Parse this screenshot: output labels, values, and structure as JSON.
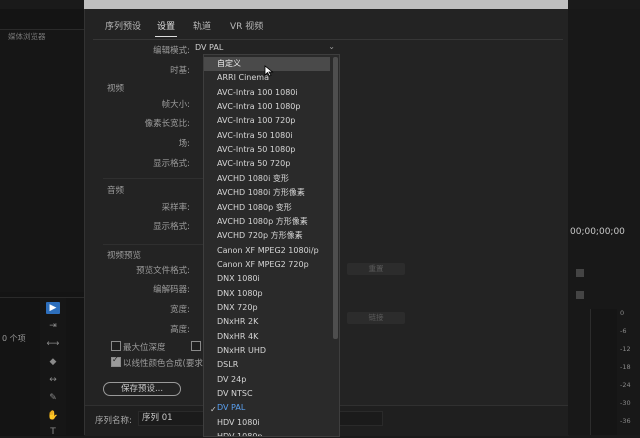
{
  "left_panel": {
    "label": "媒体浏览器",
    "item_count": "0 个项"
  },
  "tabs": [
    {
      "label": "序列预设",
      "active": false
    },
    {
      "label": "设置",
      "active": true
    },
    {
      "label": "轨道",
      "active": false
    },
    {
      "label": "VR 视频",
      "active": false
    }
  ],
  "settings": {
    "edit_mode_label": "编辑模式:",
    "edit_mode_value": "DV PAL",
    "timebase_label": "时基:",
    "video_section": "视频",
    "frame_size_label": "帧大小:",
    "pixel_aspect_label": "像素长宽比:",
    "fields_label": "场:",
    "display_format_label": "显示格式:",
    "audio_section": "音频",
    "sample_rate_label": "采样率:",
    "audio_display_format_label": "显示格式:",
    "video_preview_section": "视频预览",
    "preview_file_format_label": "预览文件格式:",
    "codec_label": "编解码器:",
    "width_label": "宽度:",
    "height_label": "高度:",
    "reset_button": "重置",
    "other_button": "链接",
    "max_depth_label": "最大位深度",
    "max_quality_label": "最",
    "linear_composite_label": "以线性颜色合成(要求",
    "save_preset_button": "保存预设...",
    "sequence_name_label": "序列名称:",
    "sequence_name_value": "序列 01"
  },
  "dropdown_options": [
    {
      "label": "自定义",
      "state": "hover"
    },
    {
      "label": "ARRI Cinema"
    },
    {
      "label": "AVC-Intra 100 1080i"
    },
    {
      "label": "AVC-Intra 100 1080p"
    },
    {
      "label": "AVC-Intra 100 720p"
    },
    {
      "label": "AVC-Intra 50 1080i"
    },
    {
      "label": "AVC-Intra 50 1080p"
    },
    {
      "label": "AVC-Intra 50 720p"
    },
    {
      "label": "AVCHD 1080i 变形"
    },
    {
      "label": "AVCHD 1080i 方形像素"
    },
    {
      "label": "AVCHD 1080p 变形"
    },
    {
      "label": "AVCHD 1080p 方形像素"
    },
    {
      "label": "AVCHD 720p 方形像素"
    },
    {
      "label": "Canon XF MPEG2 1080i/p"
    },
    {
      "label": "Canon XF MPEG2 720p"
    },
    {
      "label": "DNX 1080i"
    },
    {
      "label": "DNX 1080p"
    },
    {
      "label": "DNX 720p"
    },
    {
      "label": "DNxHR 2K"
    },
    {
      "label": "DNxHR 4K"
    },
    {
      "label": "DNxHR UHD"
    },
    {
      "label": "DSLR"
    },
    {
      "label": "DV 24p"
    },
    {
      "label": "DV NTSC"
    },
    {
      "label": "DV PAL",
      "state": "selected"
    },
    {
      "label": "HDV 1080i"
    },
    {
      "label": "HDV 1080p"
    }
  ],
  "right_panel": {
    "timecode": "00;00;00;00",
    "meter_labels": [
      "0",
      "-6",
      "-12",
      "-18",
      "-24",
      "-30",
      "-36"
    ]
  },
  "colors": {
    "accent": "#2d6fbd",
    "selected_text": "#5aa0f0",
    "hover_bg": "#4a4a4a"
  }
}
